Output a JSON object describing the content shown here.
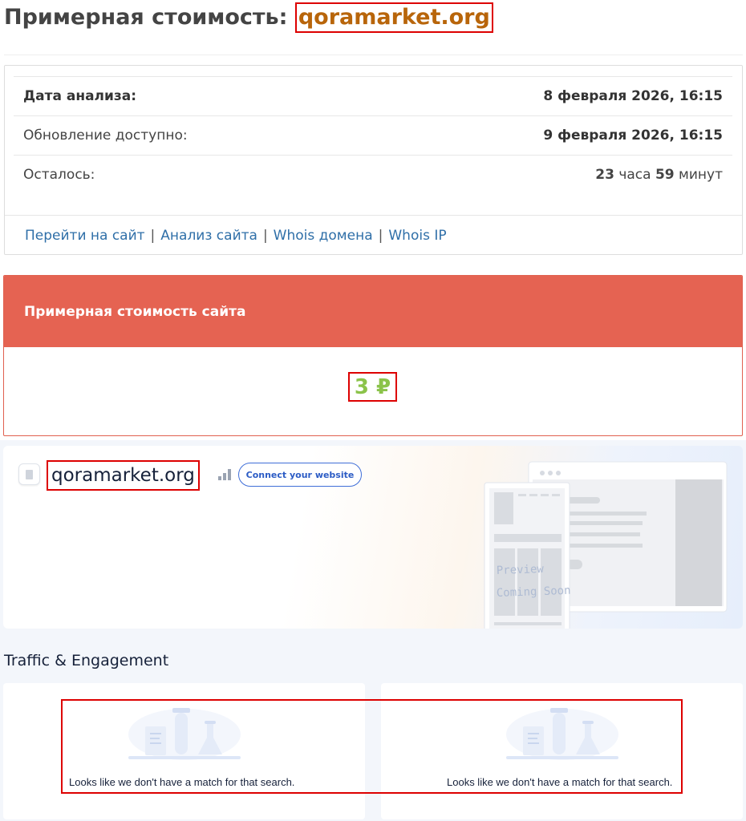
{
  "header": {
    "title_prefix": "Примерная стоимость:",
    "domain": "qoramarket.org"
  },
  "info": {
    "rows": [
      {
        "label": "Дата анализа:",
        "value": "8 февраля 2026, 16:15"
      },
      {
        "label": "Обновление доступно:",
        "value": "9 февраля 2026, 16:15"
      },
      {
        "label": "Осталось:",
        "hours": "23",
        "hours_unit": "часа",
        "minutes": "59",
        "minutes_unit": "минут"
      }
    ],
    "links": [
      "Перейти на сайт",
      "Анализ сайта",
      "Whois домена",
      "Whois IP"
    ],
    "separator": "|"
  },
  "valuation": {
    "heading": "Примерная стоимость сайта",
    "price": "3 ₽"
  },
  "similarweb": {
    "domain": "qoramarket.org",
    "connect_label": "Connect your website",
    "preview_text_1": "Preview",
    "preview_text_2": "Coming Soon",
    "section_title": "Traffic & Engagement",
    "no_match_text": "Looks like we don't have a match for that search."
  },
  "colors": {
    "domain_accent": "#b8650a",
    "price_green": "#8bc34a",
    "panel_red": "#e56352",
    "link_blue": "#2f6fa8",
    "highlight_red": "#dd0000"
  }
}
